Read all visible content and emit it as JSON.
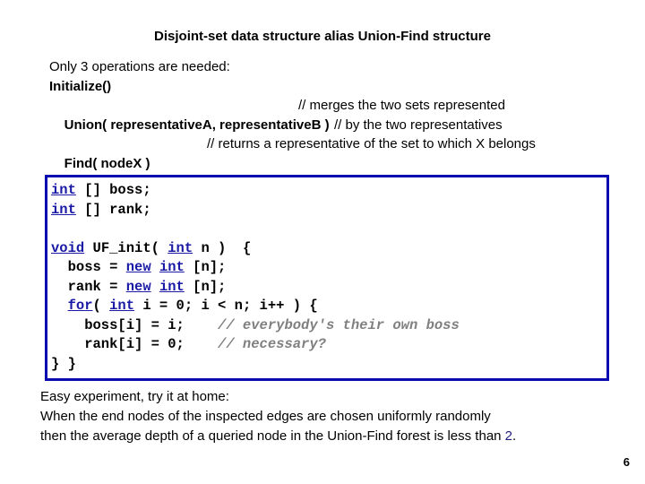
{
  "title": "Disjoint-set data structure alias Union-Find  structure",
  "intro": {
    "line1": "Only 3 operations are needed:",
    "initialize": "Initialize()",
    "union_sig": "Union( representativeA, representativeB )",
    "union_comment1": "// merges the two sets represented",
    "union_comment2": "// by the two representatives",
    "find_sig": "Find( nodeX )",
    "find_comment": "// returns a representative of the set to which X belongs"
  },
  "code": {
    "lines": [
      [
        {
          "t": "int",
          "k": "kw"
        },
        {
          "t": " [] boss;"
        }
      ],
      [
        {
          "t": "int",
          "k": "kw"
        },
        {
          "t": " [] rank;"
        }
      ],
      [],
      [
        {
          "t": "void",
          "k": "kw"
        },
        {
          "t": " UF_init( "
        },
        {
          "t": "int",
          "k": "kw"
        },
        {
          "t": " n )  {"
        }
      ],
      [
        {
          "t": "  boss = "
        },
        {
          "t": "new",
          "k": "kw"
        },
        {
          "t": " "
        },
        {
          "t": "int",
          "k": "kw"
        },
        {
          "t": " [n];"
        }
      ],
      [
        {
          "t": "  rank = "
        },
        {
          "t": "new",
          "k": "kw"
        },
        {
          "t": " "
        },
        {
          "t": "int",
          "k": "kw"
        },
        {
          "t": " [n];"
        }
      ],
      [
        {
          "t": "  "
        },
        {
          "t": "for",
          "k": "kw"
        },
        {
          "t": "( "
        },
        {
          "t": "int",
          "k": "kw"
        },
        {
          "t": " i = 0; i < n; i++ ) {"
        }
      ],
      [
        {
          "t": "    boss[i] = i;    "
        },
        {
          "t": "// everybody's their own boss",
          "k": "cm"
        }
      ],
      [
        {
          "t": "    rank[i] = 0;    "
        },
        {
          "t": "// necessary?",
          "k": "cm"
        }
      ],
      [
        {
          "t": "} }"
        }
      ]
    ]
  },
  "footer": {
    "line1": "Easy experiment, try it at home:",
    "line2": "When the end nodes of the inspected edges are chosen uniformly randomly",
    "line3_pre": "then the average depth of a queried node in the Union-Find forest is less than ",
    "line3_num": "2",
    "line3_post": "."
  },
  "page_number": "6"
}
